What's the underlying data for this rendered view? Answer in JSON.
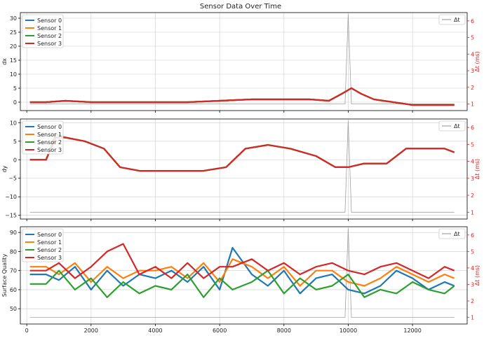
{
  "figure": {
    "title": "Sensor Data Over Time"
  },
  "colors": {
    "sensor_0": "#1f77b4",
    "sensor_1": "#ff7f0e",
    "sensor_2": "#2ca02c",
    "sensor_3": "#d62728",
    "dt": "#a0a0a0",
    "right_axis": "#d62728",
    "grid": "#cccccc"
  },
  "chart_data": [
    {
      "type": "line",
      "panel": "top",
      "title": "Sensor Data Over Time",
      "xlabel": "",
      "ylabel": "dx",
      "y2label": "Δt (ms)",
      "xlim": [
        -200,
        13700
      ],
      "ylim": [
        -3,
        32
      ],
      "y2lim": [
        0.6,
        6.5
      ],
      "xticks": [
        0,
        2000,
        4000,
        6000,
        8000,
        10000,
        12000
      ],
      "yticks": [
        0,
        5,
        10,
        15,
        20,
        25,
        30
      ],
      "y2ticks": [
        1,
        2,
        3,
        4,
        5,
        6
      ],
      "grid": true,
      "legend_left": {
        "position": "upper left",
        "entries": [
          "Sensor 0",
          "Sensor 1",
          "Sensor 2",
          "Sensor 3"
        ]
      },
      "legend_right": {
        "position": "upper right",
        "entries": [
          "Δt"
        ]
      },
      "series": [
        {
          "name": "Sensor 0",
          "x": [
            100,
            600,
            1200,
            2000,
            3000,
            4000,
            5000,
            6000,
            7000,
            8000,
            8800,
            9400,
            9800,
            10100,
            10400,
            10800,
            11400,
            12000,
            12600,
            13300
          ],
          "y": [
            0,
            0,
            0.5,
            0,
            0,
            0,
            0,
            0.5,
            1,
            1,
            1,
            0.5,
            3,
            5,
            3,
            1,
            0,
            -1,
            -1,
            -1
          ]
        },
        {
          "name": "Sensor 1",
          "x": [
            100,
            600,
            1200,
            2000,
            3000,
            4000,
            5000,
            6000,
            7000,
            8000,
            8800,
            9400,
            9800,
            10100,
            10400,
            10800,
            11400,
            12000,
            12600,
            13300
          ],
          "y": [
            0,
            0,
            0.5,
            0,
            0,
            0,
            0,
            0.5,
            1,
            1,
            1,
            0.5,
            3,
            5,
            3,
            1,
            0,
            -1,
            -1,
            -1
          ]
        },
        {
          "name": "Sensor 2",
          "x": [
            100,
            600,
            1200,
            2000,
            3000,
            4000,
            5000,
            6000,
            7000,
            8000,
            8800,
            9400,
            9800,
            10100,
            10400,
            10800,
            11400,
            12000,
            12600,
            13300
          ],
          "y": [
            0,
            0,
            0.5,
            0,
            0,
            0,
            0,
            0.5,
            1,
            1,
            1,
            0.5,
            3,
            5,
            3,
            1,
            0,
            -1,
            -1,
            -1
          ]
        },
        {
          "name": "Sensor 3",
          "x": [
            100,
            600,
            1200,
            2000,
            3000,
            4000,
            5000,
            6000,
            7000,
            8000,
            8800,
            9400,
            9800,
            10100,
            10400,
            10800,
            11400,
            12000,
            12600,
            13300
          ],
          "y": [
            0,
            0,
            0.5,
            0,
            0,
            0,
            0,
            0.5,
            1,
            1,
            1,
            0.5,
            3,
            5,
            3,
            1,
            0,
            -1,
            -1,
            -1
          ]
        }
      ],
      "dt_series": {
        "name": "Δt",
        "x": [
          100,
          1000,
          2000,
          3000,
          4000,
          5000,
          6000,
          7000,
          8000,
          9000,
          9900,
          10000,
          10100,
          11000,
          12000,
          13300
        ],
        "y": [
          1,
          1,
          1,
          1,
          1,
          1,
          1,
          1,
          1,
          1,
          1,
          6.4,
          1,
          1,
          1,
          1
        ]
      }
    },
    {
      "type": "line",
      "panel": "middle",
      "xlabel": "",
      "ylabel": "dy",
      "y2label": "Δt (ms)",
      "xlim": [
        -200,
        13700
      ],
      "ylim": [
        -16,
        11
      ],
      "y2lim": [
        0.6,
        6.5
      ],
      "xticks": [
        0,
        2000,
        4000,
        6000,
        8000,
        10000,
        12000
      ],
      "yticks": [
        -15,
        -10,
        -5,
        0,
        5,
        10
      ],
      "y2ticks": [
        1,
        2,
        3,
        4,
        5,
        6
      ],
      "grid": true,
      "legend_left": {
        "position": "upper left",
        "entries": [
          "Sensor 0",
          "Sensor 1",
          "Sensor 2",
          "Sensor 3"
        ]
      },
      "legend_right": {
        "position": "upper right",
        "entries": [
          "Δt"
        ]
      },
      "series": [
        {
          "name": "Sensor 0",
          "x": [
            100,
            600,
            900,
            1200,
            1800,
            2400,
            2900,
            3500,
            4500,
            5500,
            6200,
            6800,
            7500,
            8200,
            9000,
            9600,
            10000,
            10500,
            11200,
            11800,
            12400,
            13000,
            13300
          ],
          "y": [
            0,
            0,
            6,
            6,
            5,
            3,
            -2,
            -3,
            -3,
            -3,
            -2,
            3,
            4,
            3,
            1,
            -2,
            -2,
            -1,
            -1,
            3,
            3,
            3,
            2
          ]
        },
        {
          "name": "Sensor 1",
          "x": [
            100,
            600,
            900,
            1200,
            1800,
            2400,
            2900,
            3500,
            4500,
            5500,
            6200,
            6800,
            7500,
            8200,
            9000,
            9600,
            10000,
            10500,
            11200,
            11800,
            12400,
            13000,
            13300
          ],
          "y": [
            0,
            0,
            6,
            6,
            5,
            3,
            -2,
            -3,
            -3,
            -3,
            -2,
            3,
            4,
            3,
            1,
            -2,
            -2,
            -1,
            -1,
            3,
            3,
            3,
            2
          ]
        },
        {
          "name": "Sensor 2",
          "x": [
            100,
            600,
            900,
            1200,
            1800,
            2400,
            2900,
            3500,
            4500,
            5500,
            6200,
            6800,
            7500,
            8200,
            9000,
            9600,
            10000,
            10500,
            11200,
            11800,
            12400,
            13000,
            13300
          ],
          "y": [
            0,
            0,
            7,
            6,
            5,
            3,
            -2,
            -3,
            -3,
            -3,
            -2,
            3,
            4,
            3,
            1,
            -2,
            -2,
            -1,
            -1,
            3,
            3,
            3,
            2
          ]
        },
        {
          "name": "Sensor 3",
          "x": [
            100,
            600,
            900,
            1200,
            1800,
            2400,
            2900,
            3500,
            4500,
            5500,
            6200,
            6800,
            7500,
            8200,
            9000,
            9600,
            10000,
            10500,
            11200,
            11800,
            12400,
            13000,
            13300
          ],
          "y": [
            0,
            0,
            6,
            6,
            5,
            3,
            -2,
            -3,
            -3,
            -3,
            -2,
            3,
            4,
            3,
            1,
            -2,
            -2,
            -1,
            -1,
            3,
            3,
            3,
            2
          ]
        }
      ],
      "dt_series": {
        "name": "Δt",
        "x": [
          100,
          1000,
          2000,
          3000,
          4000,
          5000,
          6000,
          7000,
          8000,
          9000,
          9900,
          10000,
          10100,
          11000,
          12000,
          13300
        ],
        "y": [
          1,
          1,
          1,
          1,
          1,
          1,
          1,
          1,
          1,
          1,
          1,
          6.4,
          1,
          1,
          1,
          1
        ]
      }
    },
    {
      "type": "line",
      "panel": "bottom",
      "xlabel": "",
      "ylabel": "Surface Quality",
      "y2label": "Δt (ms)",
      "xlim": [
        -200,
        13700
      ],
      "ylim": [
        42,
        93
      ],
      "y2lim": [
        0.6,
        6.5
      ],
      "xticks": [
        0,
        2000,
        4000,
        6000,
        8000,
        10000,
        12000
      ],
      "yticks": [
        50,
        60,
        70,
        80,
        90
      ],
      "y2ticks": [
        1,
        2,
        3,
        4,
        5,
        6
      ],
      "grid": true,
      "legend_left": {
        "position": "upper left",
        "entries": [
          "Sensor 0",
          "Sensor 1",
          "Sensor 2",
          "Sensor 3"
        ]
      },
      "legend_right": {
        "position": "upper right",
        "entries": [
          "Δt"
        ]
      },
      "series": [
        {
          "name": "Sensor 0",
          "x": [
            100,
            600,
            1000,
            1500,
            2000,
            2500,
            3000,
            3500,
            4000,
            4500,
            5000,
            5500,
            6000,
            6400,
            7000,
            7500,
            8000,
            8500,
            9000,
            9500,
            10000,
            10500,
            11000,
            11500,
            12000,
            12500,
            13000,
            13300
          ],
          "y": [
            68,
            68,
            65,
            72,
            60,
            70,
            62,
            68,
            66,
            70,
            64,
            72,
            60,
            82,
            68,
            62,
            70,
            58,
            66,
            68,
            60,
            58,
            62,
            70,
            66,
            60,
            64,
            62
          ]
        },
        {
          "name": "Sensor 1",
          "x": [
            100,
            600,
            1000,
            1500,
            2000,
            2500,
            3000,
            3500,
            4000,
            4500,
            5000,
            5500,
            6000,
            6400,
            7000,
            7500,
            8000,
            8500,
            9000,
            9500,
            10000,
            10500,
            11000,
            11500,
            12000,
            12500,
            13000,
            13300
          ],
          "y": [
            72,
            72,
            68,
            74,
            64,
            72,
            66,
            70,
            70,
            72,
            66,
            74,
            64,
            76,
            72,
            66,
            72,
            62,
            70,
            70,
            64,
            62,
            66,
            72,
            68,
            64,
            68,
            66
          ]
        },
        {
          "name": "Sensor 2",
          "x": [
            100,
            600,
            1000,
            1500,
            2000,
            2500,
            3000,
            3500,
            4000,
            4500,
            5000,
            5500,
            6000,
            6400,
            7000,
            7500,
            8000,
            8500,
            9000,
            9500,
            10000,
            10500,
            11000,
            11500,
            12000,
            12500,
            13000,
            13300
          ],
          "y": [
            63,
            63,
            70,
            60,
            66,
            56,
            64,
            58,
            62,
            60,
            68,
            56,
            66,
            60,
            64,
            70,
            58,
            66,
            60,
            62,
            68,
            56,
            60,
            58,
            64,
            60,
            58,
            62
          ]
        },
        {
          "name": "Sensor 3",
          "x": [
            100,
            600,
            1000,
            1500,
            2000,
            2500,
            3000,
            3500,
            4000,
            4500,
            5000,
            5500,
            6000,
            6400,
            7000,
            7500,
            8000,
            8500,
            9000,
            9500,
            10000,
            10500,
            11000,
            11500,
            12000,
            12500,
            13000,
            13300
          ],
          "y": [
            70,
            70,
            74,
            66,
            72,
            80,
            84,
            68,
            72,
            66,
            74,
            66,
            72,
            72,
            76,
            70,
            74,
            68,
            72,
            74,
            70,
            68,
            72,
            74,
            70,
            66,
            72,
            70
          ]
        }
      ],
      "dt_series": {
        "name": "Δt",
        "x": [
          100,
          1000,
          2000,
          3000,
          4000,
          5000,
          6000,
          7000,
          8000,
          9000,
          9900,
          10000,
          10100,
          11000,
          12000,
          13300
        ],
        "y": [
          1,
          1,
          1,
          1,
          1,
          1,
          1,
          1,
          1,
          1,
          1,
          6.4,
          1,
          1,
          1,
          1
        ]
      }
    }
  ]
}
